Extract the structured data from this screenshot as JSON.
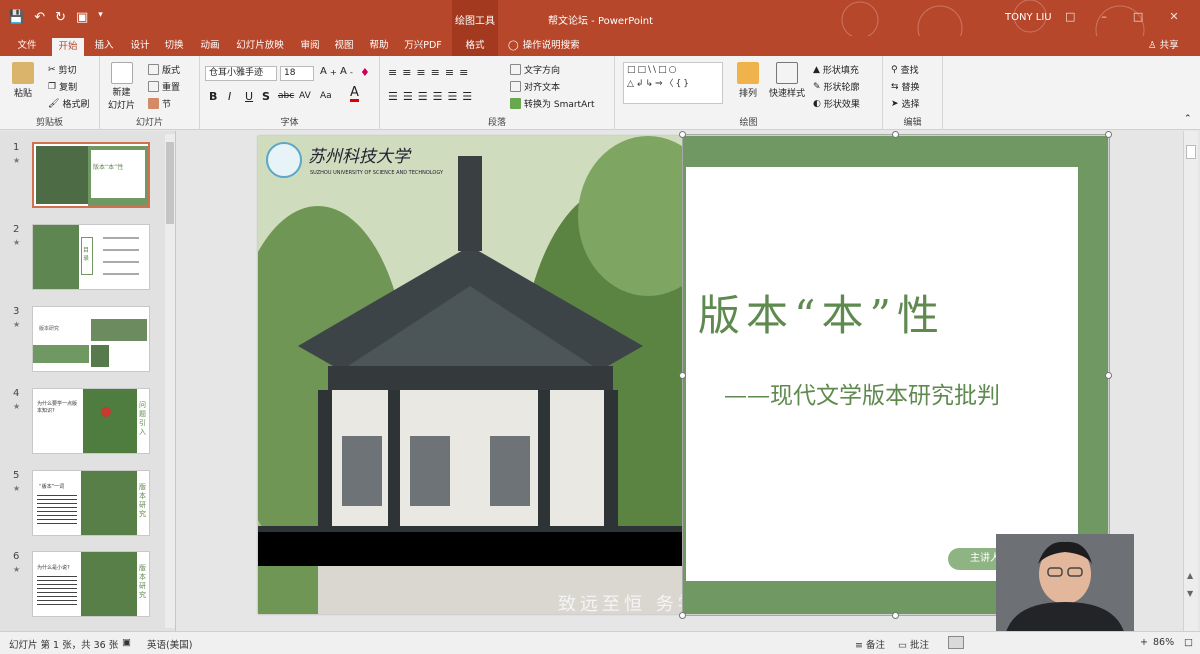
{
  "titlebar": {
    "context_tool": "绘图工具",
    "document_title": "帮文论坛  -  PowerPoint",
    "user": "TONY LIU",
    "qat": [
      "save-icon",
      "undo-icon",
      "redo-icon",
      "present-icon"
    ]
  },
  "tabs": [
    "文件",
    "开始",
    "插入",
    "设计",
    "切换",
    "动画",
    "幻灯片放映",
    "审阅",
    "视图",
    "帮助",
    "万兴PDF",
    "格式"
  ],
  "active_tab": "开始",
  "tell_me": "操作说明搜索",
  "share": "共享",
  "ribbon": {
    "clipboard": {
      "label": "剪贴板",
      "paste": "粘贴",
      "cut": "剪切",
      "copy": "复制",
      "format_painter": "格式刷"
    },
    "slides": {
      "label": "幻灯片",
      "new_slide": "新建\n幻灯片",
      "layout": "版式",
      "reset": "重置",
      "section": "节"
    },
    "font": {
      "label": "字体",
      "font_name": "仓耳小雅手迹",
      "font_size": "18",
      "bold": "B",
      "italic": "I",
      "underline": "U",
      "shadow": "S",
      "strike": "abc",
      "spacing": "AV",
      "case": "Aa"
    },
    "paragraph": {
      "label": "段落",
      "text_direction": "文字方向",
      "align_text": "对齐文本",
      "smartart": "转换为 SmartArt"
    },
    "drawing": {
      "label": "绘图",
      "arrange": "排列",
      "quick_styles": "快速样式",
      "fill": "形状填充",
      "outline": "形状轮廓",
      "effects": "形状效果"
    },
    "editing": {
      "label": "编辑",
      "find": "查找",
      "replace": "替换",
      "select": "选择"
    }
  },
  "thumbnails": [
    {
      "num": "1",
      "star": "★",
      "title": "版本“本”性",
      "selected": true
    },
    {
      "num": "2",
      "star": "★",
      "title": "目录"
    },
    {
      "num": "3",
      "star": "★",
      "title": "版本研究"
    },
    {
      "num": "4",
      "star": "★",
      "title": "问题引入",
      "text": "为什么要学一点版本知识?"
    },
    {
      "num": "5",
      "star": "★",
      "title": "版本研究",
      "text": "“版本”一词"
    },
    {
      "num": "6",
      "star": "★",
      "title": "版本研究",
      "text": "为什么是小说?"
    }
  ],
  "slide": {
    "university_cn": "苏州科技大学",
    "university_en": "SUZHOU UNIVERSITY OF SCIENCE AND TECHNOLOGY",
    "title": "版本“本”性",
    "subtitle": "——现代文学版本研究批判",
    "presenter": "主讲人:刘开",
    "motto": "致远至恒  务学修身"
  },
  "statusbar": {
    "slide_info": "幻灯片 第 1 张，共 36 张",
    "language": "英语(美国)",
    "notes": "备注",
    "comments": "批注",
    "zoom": "86%"
  },
  "colors": {
    "accent": "#b7472a",
    "slide_green": "#6f9862",
    "title_green": "#5f8a4f"
  }
}
